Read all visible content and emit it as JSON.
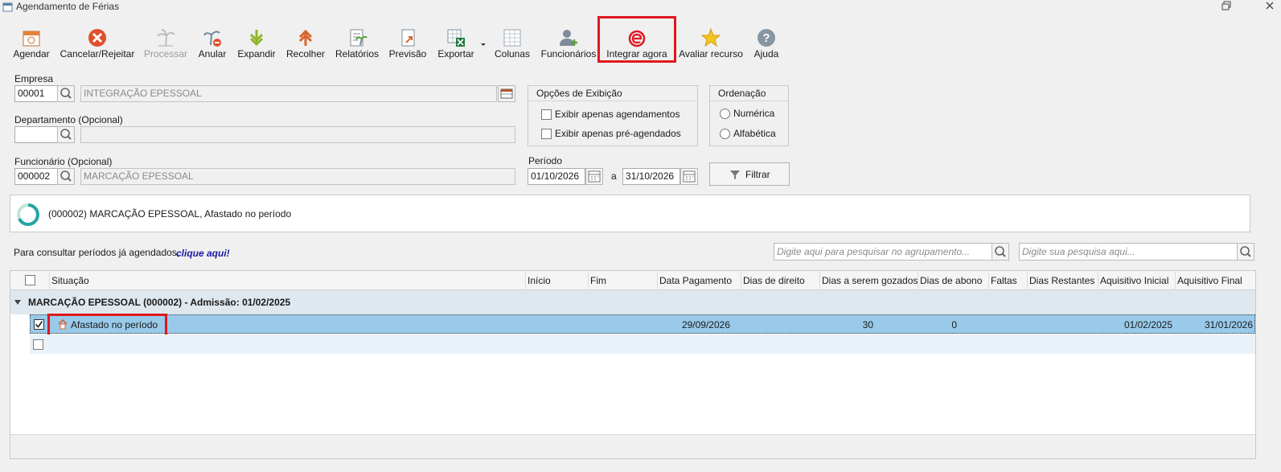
{
  "window": {
    "title": "Agendamento de Férias"
  },
  "toolbar": [
    {
      "label": "Agendar",
      "icon": "calendar-icon",
      "enabled": true
    },
    {
      "label": "Cancelar/Rejeitar",
      "icon": "cancel-icon",
      "enabled": true
    },
    {
      "label": "Processar",
      "icon": "palm-tree-icon",
      "enabled": false
    },
    {
      "label": "Anular",
      "icon": "annul-icon",
      "enabled": true
    },
    {
      "label": "Expandir",
      "icon": "expand-arrow-icon",
      "enabled": true
    },
    {
      "label": "Recolher",
      "icon": "collapse-arrow-icon",
      "enabled": true
    },
    {
      "label": "Relatórios",
      "icon": "report-icon",
      "enabled": true
    },
    {
      "label": "Previsão",
      "icon": "preview-icon",
      "enabled": true
    },
    {
      "label": "Exportar",
      "icon": "excel-export-icon",
      "enabled": true
    },
    {
      "label": "Colunas",
      "icon": "columns-icon",
      "enabled": true
    },
    {
      "label": "Funcionários",
      "icon": "employee-add-icon",
      "enabled": true
    },
    {
      "label": "Integrar agora",
      "icon": "epessoal-logo-icon",
      "enabled": true
    },
    {
      "label": "Avaliar recurso",
      "icon": "star-icon",
      "enabled": true
    },
    {
      "label": "Ajuda",
      "icon": "help-icon",
      "enabled": true
    }
  ],
  "form": {
    "empresa": {
      "label": "Empresa",
      "code": "00001",
      "name": "INTEGRAÇÃO EPESSOAL"
    },
    "departamento": {
      "label": "Departamento (Opcional)",
      "code": "",
      "name": ""
    },
    "funcionario": {
      "label": "Funcionário (Opcional)",
      "code": "000002",
      "name": "MARCAÇÃO EPESSOAL"
    },
    "periodo": {
      "label": "Período",
      "start": "01/10/2026",
      "sep": "a",
      "end": "31/10/2026"
    },
    "filter_label": "Filtrar"
  },
  "options": {
    "title": "Opções de Exibição",
    "items": [
      "Exibir apenas agendamentos",
      "Exibir apenas pré-agendados"
    ]
  },
  "ordering": {
    "title": "Ordenação",
    "items": [
      "Numérica",
      "Alfabética"
    ]
  },
  "status": {
    "message": "(000002) MARCAÇÃO EPESSOAL, Afastado no período"
  },
  "consult": {
    "text": "Para consultar períodos já agendados,",
    "link": "clique aqui!"
  },
  "search": {
    "group_placeholder": "Digite aqui para pesquisar no agrupamento...",
    "main_placeholder": "Digite sua pesquisa aqui..."
  },
  "grid": {
    "columns": [
      "Situação",
      "Início",
      "Fim",
      "Data Pagamento",
      "Dias de direito",
      "Dias a serem gozados",
      "Dias de abono",
      "Faltas",
      "Dias Restantes",
      "Aquisitivo Inicial",
      "Aquisitivo Final"
    ],
    "group": "MARCAÇÃO EPESSOAL (000002)  - Admissão: 01/02/2025",
    "rows": [
      {
        "situacao": "Afastado no período",
        "inicio": "",
        "fim": "",
        "data_pagamento": "29/09/2026",
        "dias_direito": "",
        "dias_gozados": "30",
        "dias_abono": "0",
        "faltas": "",
        "dias_restantes": "",
        "aquisitivo_inicial": "01/02/2025",
        "aquisitivo_final": "31/01/2026",
        "checked": true
      }
    ]
  },
  "colors": {
    "highlight": "#e0171f",
    "selected_row": "#99caea",
    "group_row": "#dfe8ee",
    "link": "#1a1aa6"
  }
}
